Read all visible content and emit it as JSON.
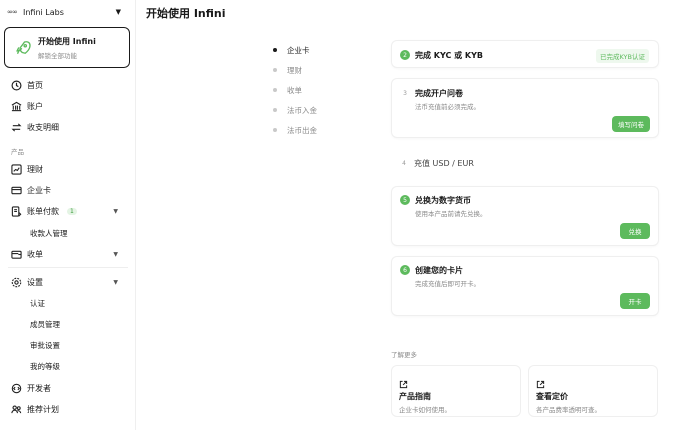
{
  "sidebar": {
    "org": {
      "logo": "∞∞",
      "name": "Infini Labs"
    },
    "start_card": {
      "title": "开始使用 Infini",
      "subtitle": "解锁全部功能"
    },
    "items": {
      "home": "首页",
      "account": "账户",
      "transactions": "收支明细",
      "products_label": "产品",
      "wealth": "理财",
      "corporate_card": "企业卡",
      "bill_pay": "账单付款",
      "bill_pay_badge": "1",
      "payee_mgmt": "收款人管理",
      "collect": "收单",
      "settings": "设置",
      "verification": "认证",
      "members": "成员管理",
      "approval": "审批设置",
      "my_level": "我的等级",
      "developer": "开发者",
      "referral": "推荐计划"
    }
  },
  "main": {
    "title": "开始使用 Infini",
    "steps_nav": [
      "企业卡",
      "理财",
      "收单",
      "法币入金",
      "法币出金"
    ],
    "cards": {
      "kyc": {
        "num": "2",
        "title": "完成 KYC 或 KYB",
        "status": "已完成KYB认证"
      },
      "survey": {
        "num": "3",
        "title": "完成开户问卷",
        "desc": "法币充值前必须完成。",
        "button": "填写问卷"
      },
      "deposit": {
        "num": "4",
        "title": "充值 USD / EUR"
      },
      "convert": {
        "num": "5",
        "title": "兑换为数字货币",
        "desc": "使用本产品前请先兑换。",
        "button": "兑换"
      },
      "create_card": {
        "num": "6",
        "title": "创建您的卡片",
        "desc": "完成充值后即可开卡。",
        "button": "开卡"
      }
    },
    "learn_more": {
      "label": "了解更多",
      "guide": {
        "title": "产品指南",
        "desc": "企业卡如何使用。"
      },
      "pricing": {
        "title": "查看定价",
        "desc": "各产品费率透明可查。"
      }
    }
  },
  "colors": {
    "accent_green": "#5dba5d",
    "text": "#1a1a1a",
    "muted": "#8a8a8a"
  }
}
